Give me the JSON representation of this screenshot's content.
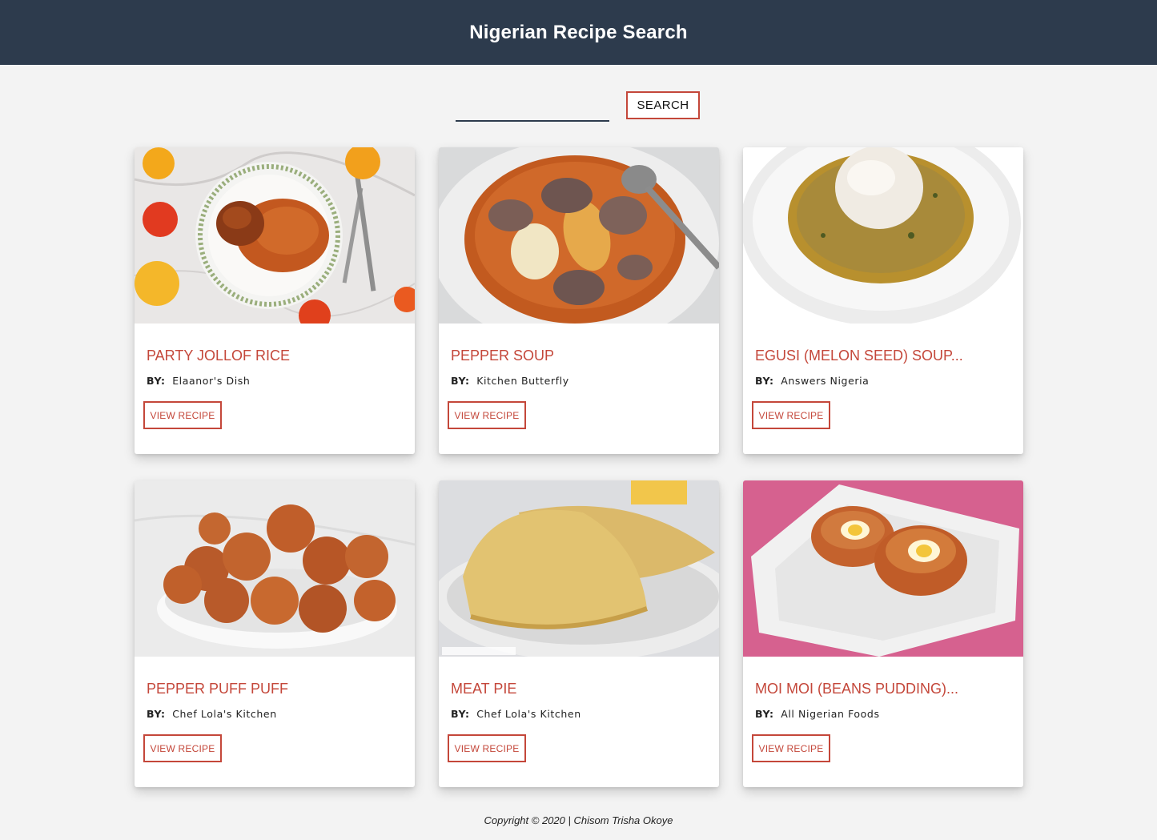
{
  "header": {
    "title": "Nigerian Recipe Search"
  },
  "search": {
    "value": "",
    "placeholder": "",
    "button_label": "SEARCH"
  },
  "recipes": [
    {
      "title": "PARTY JOLLOF RICE",
      "by_label": "BY:",
      "author": "Elaanor's Dish",
      "button_label": "VIEW RECIPE"
    },
    {
      "title": "PEPPER SOUP",
      "by_label": "BY:",
      "author": "Kitchen Butterfly",
      "button_label": "VIEW RECIPE"
    },
    {
      "title": "EGUSI (MELON SEED) SOUP...",
      "by_label": "BY:",
      "author": "Answers Nigeria",
      "button_label": "VIEW RECIPE"
    },
    {
      "title": "PEPPER PUFF PUFF",
      "by_label": "BY:",
      "author": "Chef Lola's Kitchen",
      "button_label": "VIEW RECIPE"
    },
    {
      "title": "MEAT PIE",
      "by_label": "BY:",
      "author": "Chef Lola's Kitchen",
      "button_label": "VIEW RECIPE"
    },
    {
      "title": "MOI MOI (BEANS PUDDING)...",
      "by_label": "BY:",
      "author": "All Nigerian Foods",
      "button_label": "VIEW RECIPE"
    }
  ],
  "footer": {
    "text": "Copyright © 2020 | Chisom Trisha Okoye"
  },
  "colors": {
    "navbar": "#2d3b4d",
    "accent": "#c4473a",
    "background": "#f3f3f3"
  }
}
